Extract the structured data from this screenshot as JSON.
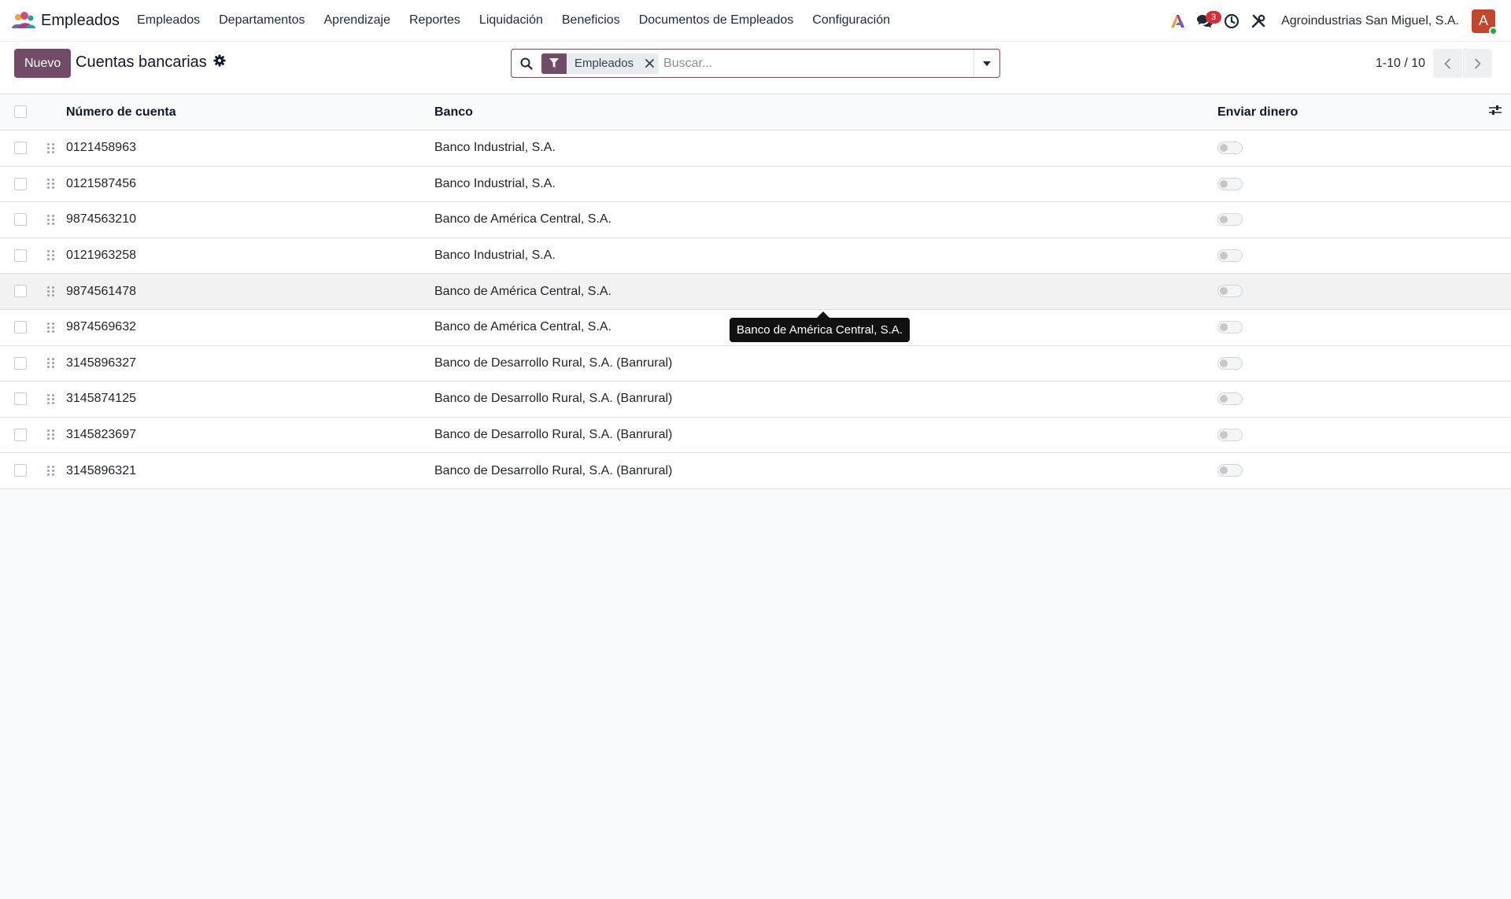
{
  "navbar": {
    "app_name": "Empleados",
    "menu": [
      {
        "label": "Empleados"
      },
      {
        "label": "Departamentos"
      },
      {
        "label": "Aprendizaje"
      },
      {
        "label": "Reportes"
      },
      {
        "label": "Liquidación"
      },
      {
        "label": "Beneficios"
      },
      {
        "label": "Documentos de Empleados"
      },
      {
        "label": "Configuración"
      }
    ],
    "messages_badge": "3",
    "company": "Agroindustrias San Miguel, S.A.",
    "avatar_initial": "A",
    "colors": {
      "brand": "#714b67",
      "avatar": "#c2452d",
      "badge": "#d32f3b",
      "online": "#28a745"
    }
  },
  "control_panel": {
    "new_button": "Nuevo",
    "title": "Cuentas bancarias",
    "search": {
      "facet_label": "Empleados",
      "placeholder": "Buscar..."
    },
    "pager": "1-10 / 10"
  },
  "table": {
    "columns": {
      "account": "Número de cuenta",
      "bank": "Banco",
      "send_money": "Enviar dinero"
    },
    "rows": [
      {
        "account": "0121458963",
        "bank": "Banco Industrial, S.A.",
        "send_money": false
      },
      {
        "account": "0121587456",
        "bank": "Banco Industrial, S.A.",
        "send_money": false
      },
      {
        "account": "9874563210",
        "bank": "Banco de América Central, S.A.",
        "send_money": false
      },
      {
        "account": "0121963258",
        "bank": "Banco Industrial, S.A.",
        "send_money": false
      },
      {
        "account": "9874561478",
        "bank": "Banco de América Central, S.A.",
        "send_money": false
      },
      {
        "account": "9874569632",
        "bank": "Banco de América Central, S.A.",
        "send_money": false
      },
      {
        "account": "3145896327",
        "bank": "Banco de Desarrollo Rural, S.A. (Banrural)",
        "send_money": false
      },
      {
        "account": "3145874125",
        "bank": "Banco de Desarrollo Rural, S.A. (Banrural)",
        "send_money": false
      },
      {
        "account": "3145823697",
        "bank": "Banco de Desarrollo Rural, S.A. (Banrural)",
        "send_money": false
      },
      {
        "account": "3145896321",
        "bank": "Banco de Desarrollo Rural, S.A. (Banrural)",
        "send_money": false
      }
    ]
  },
  "tooltip": {
    "text": "Banco de América Central, S.A."
  }
}
